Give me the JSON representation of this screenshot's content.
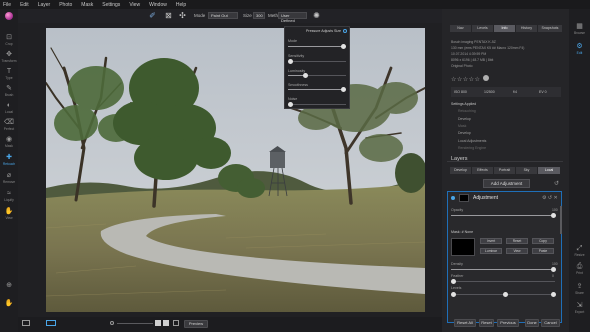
{
  "menubar": {
    "items": [
      "File",
      "Edit",
      "Layer",
      "Photo",
      "Mask",
      "Settings",
      "View",
      "Window",
      "Help"
    ]
  },
  "toolbar": {
    "mode_label": "Mode",
    "mode_value": "Paint Out",
    "size_label": "Size",
    "size_value": "300",
    "method_label": "Method",
    "method_value": "User Defined"
  },
  "tools": [
    {
      "name": "crop",
      "label": "Crop",
      "icon": "⊡"
    },
    {
      "name": "transform",
      "label": "Transform",
      "icon": "✥"
    },
    {
      "name": "type",
      "label": "Type",
      "icon": "T"
    },
    {
      "name": "brush",
      "label": "Brush",
      "icon": "✎"
    },
    {
      "name": "local",
      "label": "Local",
      "icon": "◐"
    },
    {
      "name": "perfect-eraser",
      "label": "Perfect",
      "icon": "⌫"
    },
    {
      "name": "mask",
      "label": "Mask",
      "icon": "◉"
    },
    {
      "name": "retouch",
      "label": "Retouch",
      "icon": "✚",
      "active": true
    },
    {
      "name": "remove",
      "label": "Remove",
      "icon": "⌀"
    },
    {
      "name": "liquify",
      "label": "Liquify",
      "icon": "≈"
    },
    {
      "name": "view",
      "label": "View",
      "icon": "✋"
    }
  ],
  "popup": {
    "title": "Pressure Adjusts Size",
    "sliders": [
      {
        "label": "Mode",
        "value": "",
        "level": 0.95
      },
      {
        "label": "Sensitivity",
        "value": "",
        "level": 0.0
      },
      {
        "label": "Luminosity",
        "value": "",
        "level": 0.3
      },
      {
        "label": "Smoothness",
        "value": "",
        "level": 0.95
      },
      {
        "label": "Noise",
        "value": "",
        "level": 0.0
      }
    ]
  },
  "bottom": {
    "preview_label": "Preview"
  },
  "right": {
    "tabs": [
      "Nav",
      "Levels",
      "Info",
      "History",
      "Snapshots"
    ],
    "active_tab": "Info",
    "info_lines": [
      "Bosch imaging PENTAX K-5Z",
      "130 mm (ems PENTAX K5 ## Macro 120mm F4)",
      "10.07.2014 4:39:59 PM",
      "8096 x 6196 | 48.7 MB | 8bit",
      "Original Photo"
    ],
    "stats": [
      "ISO 800",
      "1/2500",
      "f/4",
      "EV 0"
    ],
    "settings_header": "Settings Applied",
    "settings_items": [
      "Develop",
      "Retouching",
      "Mask",
      "Local Adjustments",
      "Rendering Engine"
    ],
    "layers_title": "Layers",
    "layer_tabs": [
      "Develop",
      "Effects",
      "Portrait",
      "Sky",
      "Local"
    ],
    "active_layer_tab": "Local",
    "add_adjustment": "Add Adjustment",
    "layer_name": "Adjustment",
    "opacity_label": "Opacity",
    "opacity_value": "100",
    "mask_label": "Mask: # None",
    "mask_buttons": [
      "Invert",
      "Reset",
      "Copy",
      "Luminar",
      "View",
      "Paste"
    ],
    "density_label": "Density",
    "density_value": "100",
    "feather_label": "Feather",
    "feather_value": "0",
    "levels_label": "Levels"
  },
  "footer": {
    "reset_all": "Reset All",
    "reset": "Reset",
    "previous": "Previous",
    "done": "Done",
    "cancel": "Cancel"
  },
  "farright": [
    {
      "name": "browse",
      "label": "Browse",
      "icon": "▦"
    },
    {
      "name": "edit",
      "label": "Edit",
      "icon": "⚙",
      "active": true
    },
    {
      "name": "resize",
      "label": "Resize",
      "icon": "⤢"
    },
    {
      "name": "print",
      "label": "Print",
      "icon": "⎙"
    },
    {
      "name": "share",
      "label": "Share",
      "icon": "⇪"
    },
    {
      "name": "export",
      "label": "Export",
      "icon": "⇲"
    }
  ],
  "colors": {
    "accent": "#4aa6e8",
    "panel": "#252528",
    "menubar": "#1a1a1c"
  }
}
